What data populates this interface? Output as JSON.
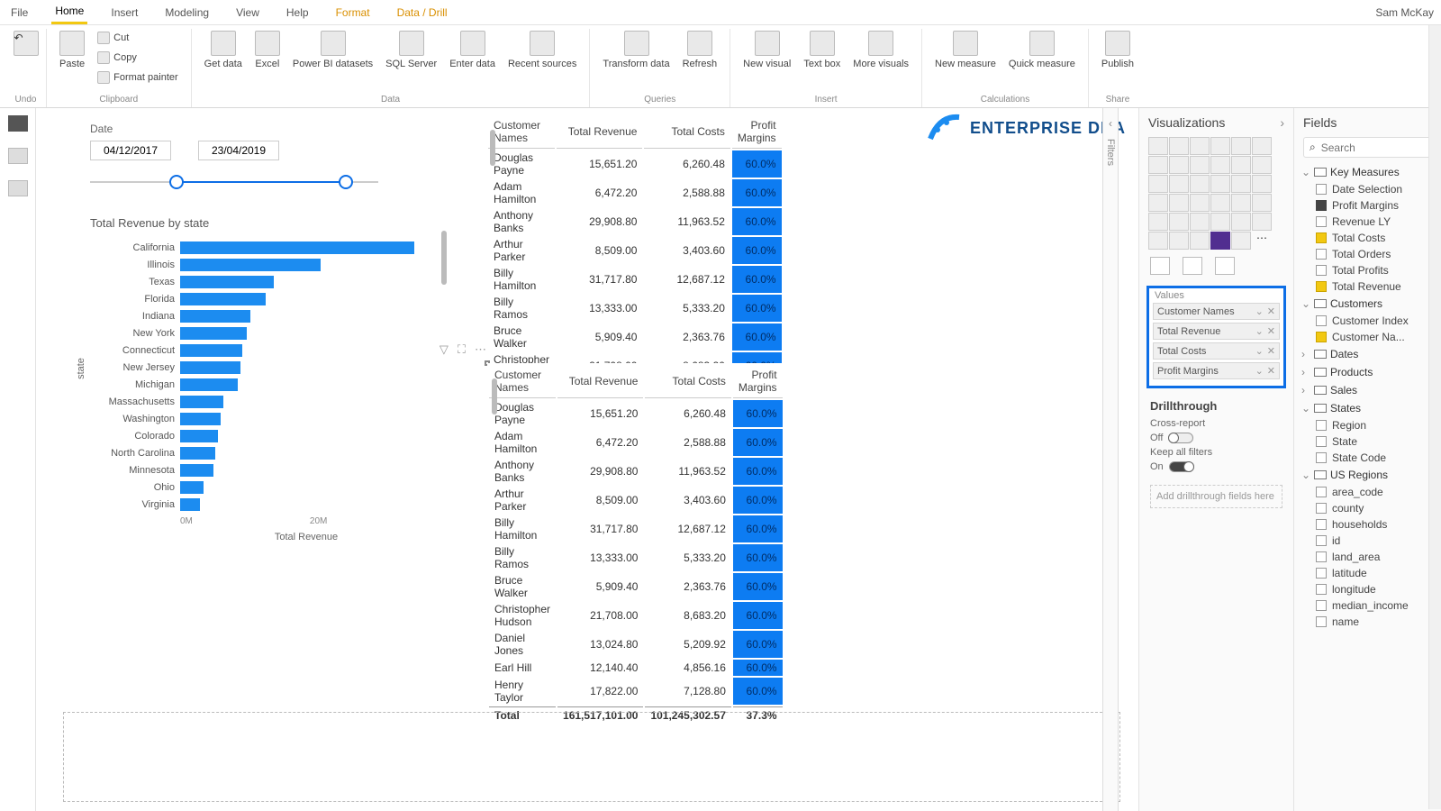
{
  "user": "Sam McKay",
  "menu": {
    "tabs": [
      "File",
      "Home",
      "Insert",
      "Modeling",
      "View",
      "Help",
      "Format",
      "Data / Drill"
    ],
    "active": 1,
    "orange": [
      6,
      7
    ]
  },
  "ribbon": {
    "undo": "Undo",
    "clipboard": {
      "paste": "Paste",
      "cut": "Cut",
      "copy": "Copy",
      "fp": "Format painter",
      "label": "Clipboard"
    },
    "data": {
      "get": "Get data",
      "excel": "Excel",
      "pbi": "Power BI datasets",
      "sql": "SQL Server",
      "enter": "Enter data",
      "recent": "Recent sources",
      "label": "Data"
    },
    "queries": {
      "transform": "Transform data",
      "refresh": "Refresh",
      "label": "Queries"
    },
    "insert": {
      "newv": "New visual",
      "text": "Text box",
      "more": "More visuals",
      "label": "Insert"
    },
    "calc": {
      "newm": "New measure",
      "quick": "Quick measure",
      "label": "Calculations"
    },
    "share": {
      "publish": "Publish",
      "label": "Share"
    }
  },
  "logo": {
    "text": "ENTERPRISE DNA"
  },
  "slicer": {
    "label": "Date",
    "from": "04/12/2017",
    "to": "23/04/2019"
  },
  "chart_data": {
    "type": "bar",
    "title": "Total Revenue by state",
    "ylabel": "state",
    "xlabel": "Total Revenue",
    "xticks": [
      "0M",
      "20M"
    ],
    "categories": [
      "California",
      "Illinois",
      "Texas",
      "Florida",
      "Indiana",
      "New York",
      "Connecticut",
      "New Jersey",
      "Michigan",
      "Massachusetts",
      "Washington",
      "Colorado",
      "North Carolina",
      "Minnesota",
      "Ohio",
      "Virginia"
    ],
    "values": [
      30,
      18,
      12,
      11,
      9,
      8.5,
      8,
      7.7,
      7.4,
      5.5,
      5.2,
      4.8,
      4.5,
      4.3,
      3,
      2.5
    ]
  },
  "table": {
    "cols": [
      "Customer Names",
      "Total Revenue",
      "Total Costs",
      "Profit Margins"
    ],
    "rows": [
      [
        "Douglas Payne",
        "15,651.20",
        "6,260.48",
        "60.0%"
      ],
      [
        "Adam Hamilton",
        "6,472.20",
        "2,588.88",
        "60.0%"
      ],
      [
        "Anthony Banks",
        "29,908.80",
        "11,963.52",
        "60.0%"
      ],
      [
        "Arthur Parker",
        "8,509.00",
        "3,403.60",
        "60.0%"
      ],
      [
        "Billy Hamilton",
        "31,717.80",
        "12,687.12",
        "60.0%"
      ],
      [
        "Billy Ramos",
        "13,333.00",
        "5,333.20",
        "60.0%"
      ],
      [
        "Bruce Walker",
        "5,909.40",
        "2,363.76",
        "60.0%"
      ],
      [
        "Christopher Hudson",
        "21,708.00",
        "8,683.20",
        "60.0%"
      ],
      [
        "Daniel Jones",
        "13,024.80",
        "5,209.92",
        "60.0%"
      ],
      [
        "Earl Hill",
        "12,140.40",
        "4,856.16",
        "60.0%"
      ],
      [
        "Henry Taylor",
        "17,822.00",
        "7,128.80",
        "60.0%"
      ]
    ],
    "total": [
      "Total",
      "161,517,101.00",
      "101,245,302.57",
      "37.3%"
    ]
  },
  "viz": {
    "title": "Visualizations",
    "values_label": "Values",
    "fields": [
      "Customer Names",
      "Total Revenue",
      "Total Costs",
      "Profit Margins"
    ],
    "drill": {
      "title": "Drillthrough",
      "cross": "Cross-report",
      "off": "Off",
      "keep": "Keep all filters",
      "on": "On",
      "hint": "Add drillthrough fields here"
    }
  },
  "filters": {
    "label": "Filters"
  },
  "fields": {
    "title": "Fields",
    "search": "Search",
    "tables": [
      {
        "name": "Key Measures",
        "open": true,
        "fields": [
          {
            "n": "Date Selection",
            "c": 0
          },
          {
            "n": "Profit Margins",
            "c": 2
          },
          {
            "n": "Revenue LY",
            "c": 0
          },
          {
            "n": "Total Costs",
            "c": 1
          },
          {
            "n": "Total Orders",
            "c": 0
          },
          {
            "n": "Total Profits",
            "c": 0
          },
          {
            "n": "Total Revenue",
            "c": 1
          }
        ]
      },
      {
        "name": "Customers",
        "open": true,
        "fields": [
          {
            "n": "Customer Index",
            "c": 0
          },
          {
            "n": "Customer Na...",
            "c": 1
          }
        ]
      },
      {
        "name": "Dates",
        "open": false,
        "fields": []
      },
      {
        "name": "Products",
        "open": false,
        "fields": []
      },
      {
        "name": "Sales",
        "open": false,
        "fields": []
      },
      {
        "name": "States",
        "open": true,
        "fields": [
          {
            "n": "Region",
            "c": 0
          },
          {
            "n": "State",
            "c": 0
          },
          {
            "n": "State Code",
            "c": 0
          }
        ]
      },
      {
        "name": "US Regions",
        "open": true,
        "fields": [
          {
            "n": "area_code",
            "c": 0
          },
          {
            "n": "county",
            "c": 0
          },
          {
            "n": "households",
            "c": 0
          },
          {
            "n": "id",
            "c": 0
          },
          {
            "n": "land_area",
            "c": 0
          },
          {
            "n": "latitude",
            "c": 0
          },
          {
            "n": "longitude",
            "c": 0
          },
          {
            "n": "median_income",
            "c": 0
          },
          {
            "n": "name",
            "c": 0
          }
        ]
      }
    ]
  }
}
